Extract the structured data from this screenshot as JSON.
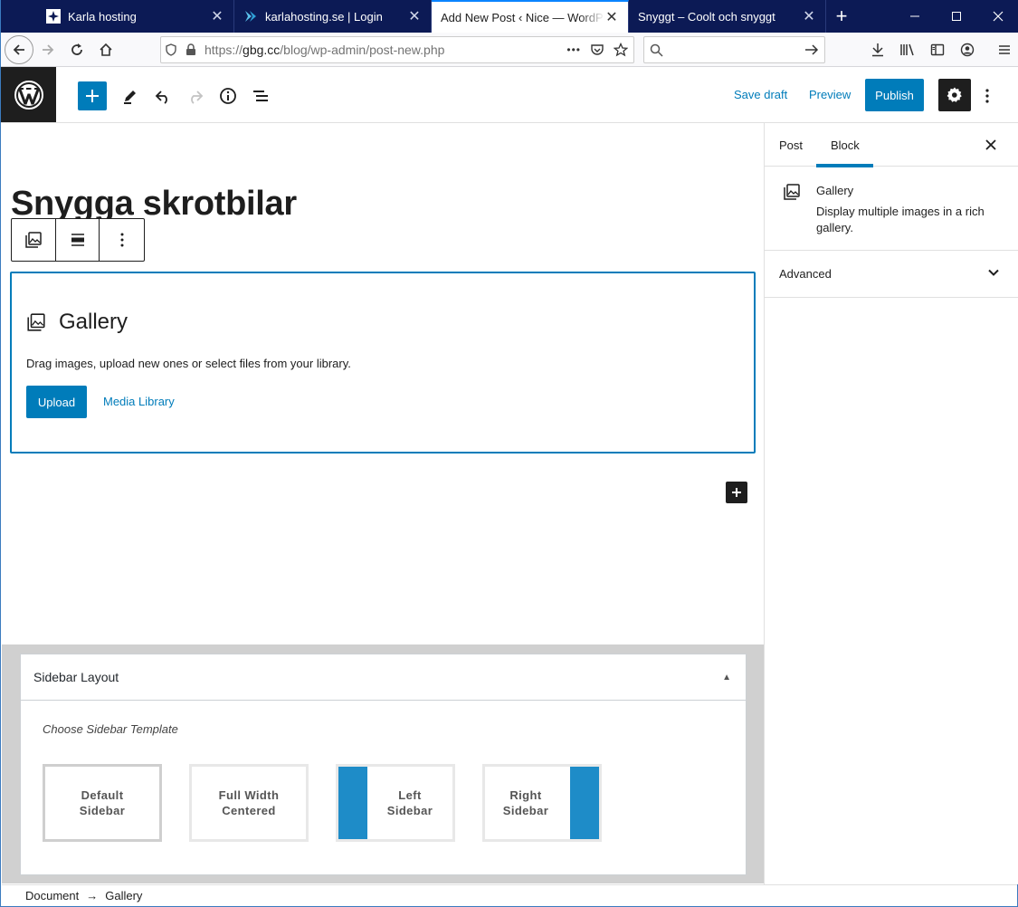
{
  "browser": {
    "tabs": [
      {
        "label": "Karla hosting",
        "icon": "karla-hosting-favicon",
        "active": false
      },
      {
        "label": "karlahosting.se | Login",
        "icon": "karlahosting-login-favicon",
        "active": false
      },
      {
        "label": "Add New Post ‹ Nice — WordPress",
        "icon": "",
        "active": true
      },
      {
        "label": "Snyggt – Coolt och snyggt",
        "icon": "",
        "active": false
      }
    ],
    "url_prefix": "https://",
    "url_domain": "gbg.cc",
    "url_path": "/blog/wp-admin/post-new.php",
    "new_tab_glyph": "+",
    "window_controls": {
      "minimize": "—",
      "maximize": "☐",
      "close": "✕"
    },
    "more_dots": "•••"
  },
  "wp_header": {
    "save_draft": "Save draft",
    "preview": "Preview",
    "publish": "Publish"
  },
  "editor": {
    "post_title": "Snygga skrotbilar",
    "gallery_block": {
      "title": "Gallery",
      "instructions": "Drag images, upload new ones or select files from your library.",
      "upload_label": "Upload",
      "media_library_label": "Media Library"
    }
  },
  "meta_box": {
    "title": "Sidebar Layout",
    "subtitle": "Choose Sidebar Template",
    "toggle_glyph": "▲",
    "options": [
      {
        "label": "Default\nSidebar",
        "selected": true
      },
      {
        "label": "Full Width\nCentered",
        "selected": false
      },
      {
        "label": "Left\nSidebar",
        "selected": false
      },
      {
        "label": "Right\nSidebar",
        "selected": false
      }
    ]
  },
  "sidebar": {
    "tabs": [
      "Post",
      "Block"
    ],
    "active_tab": "Block",
    "block_name": "Gallery",
    "block_description": "Display multiple images in a rich gallery.",
    "advanced_label": "Advanced"
  },
  "footer": {
    "crumbs": [
      "Document",
      "Gallery"
    ],
    "arrow": "→"
  },
  "colors": {
    "accent": "#007cba",
    "titlebar": "#0c1a55",
    "dark": "#1e1e1e",
    "sidebar_bar": "#1e8cc8"
  }
}
